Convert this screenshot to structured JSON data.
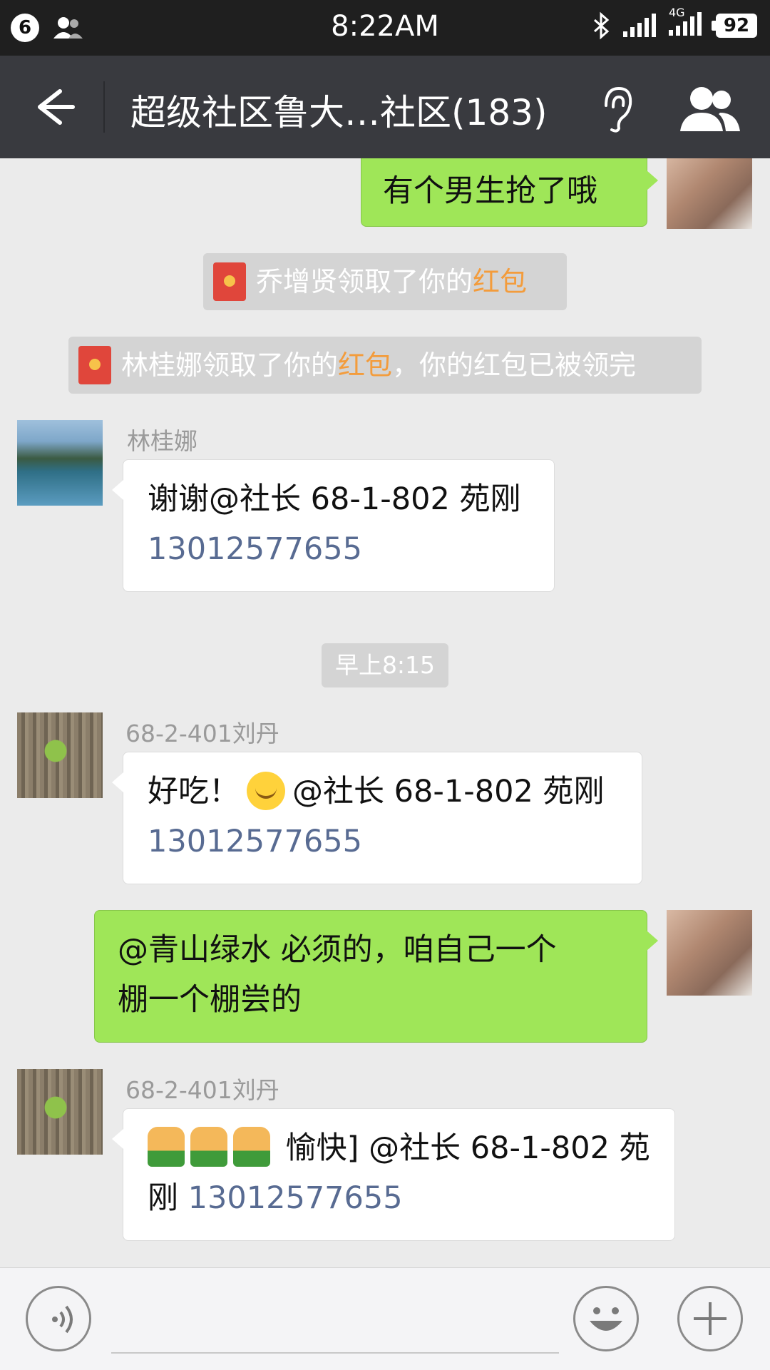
{
  "status_bar": {
    "notification_count": "6",
    "time": "8:22AM",
    "network": "4G",
    "sim_index": "2",
    "battery": "92"
  },
  "header": {
    "title": "超级社区鲁大…社区(183)",
    "icons": [
      "back-arrow-icon",
      "earpiece-icon",
      "group-members-icon"
    ]
  },
  "messages": {
    "m1": {
      "text": "有个男生抢了哦"
    },
    "sys1": {
      "name": "乔增贤领取了你的",
      "link": "红包"
    },
    "sys2": {
      "name": "林桂娜领取了你的",
      "link": "红包",
      "suffix": "，你的红包已被领完"
    },
    "m2": {
      "sender": "林桂娜",
      "text": "谢谢@社长 68-1-802 苑刚",
      "phone": "13012577655"
    },
    "time_divider": "早上8:15",
    "m3": {
      "sender": "68-2-401刘丹",
      "text_a": "好吃！",
      "text_b": "@社长 68-1-802 苑刚",
      "phone": "13012577655"
    },
    "m4": {
      "line1": "@青山绿水  必须的，咱自己一个",
      "line2": "棚一个棚尝的"
    },
    "m5": {
      "sender": "68-2-401刘丹",
      "text_a": " 愉快] @社长 68-1-802 苑",
      "text_b": "刚 ",
      "phone": "13012577655"
    }
  },
  "input_bar": {
    "placeholder": "",
    "icons": [
      "voice-icon",
      "emoji-icon",
      "plus-icon"
    ]
  },
  "colors": {
    "title_bar": "#393a3f",
    "my_bubble": "#9fe658",
    "red_packet_link": "#f39c3c",
    "phone_link": "#586b92"
  }
}
